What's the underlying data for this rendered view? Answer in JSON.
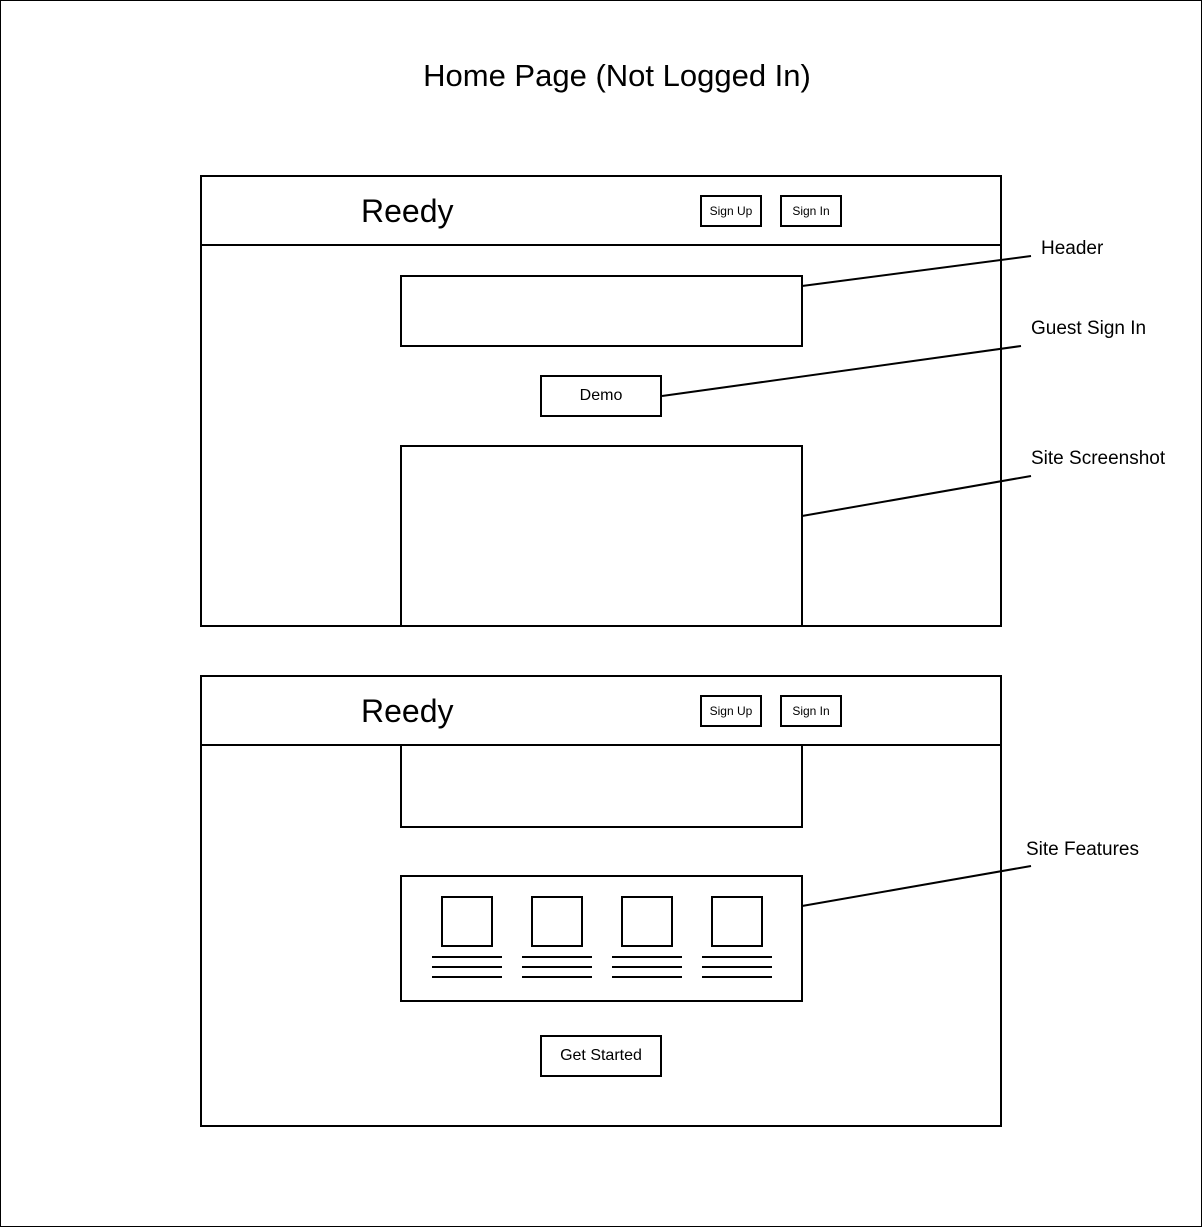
{
  "title": "Home Page (Not Logged In)",
  "mockups": [
    {
      "logo": "Reedy",
      "buttons": {
        "sign_up": "Sign Up",
        "sign_in": "Sign In"
      },
      "demo_button": "Demo"
    },
    {
      "logo": "Reedy",
      "buttons": {
        "sign_up": "Sign Up",
        "sign_in": "Sign In"
      },
      "features_count": 4,
      "cta_button": "Get Started"
    }
  ],
  "callouts": {
    "header": "Header",
    "guest_sign_in": "Guest Sign In",
    "site_screenshot": "Site Screenshot",
    "site_features": "Site Features"
  }
}
